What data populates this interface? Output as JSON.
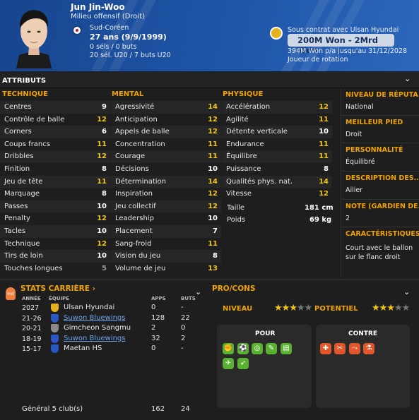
{
  "player": {
    "name": "Jun Jin-Woo",
    "position": "Milieu offensif (Droit)",
    "nationality": "Sud-Coréen",
    "age": "27 ans (9/9/1999)",
    "caps": "0 séls / 0 buts",
    "youth_caps": "20 sél. U20 / 7 buts U20"
  },
  "contract": {
    "club_text": "Sous contrat avec Ulsan Hyundai",
    "value": "200M Won - 2Mrd Won",
    "salary": "394M Won p/a jusqu'au 31/12/2028",
    "role": "Joueur de rotation"
  },
  "attributes": {
    "title": "ATTRIBUTS",
    "technique": {
      "title": "TECHNIQUE",
      "items": [
        {
          "label": "Centres",
          "value": "9"
        },
        {
          "label": "Contrôle de balle",
          "value": "12"
        },
        {
          "label": "Corners",
          "value": "6"
        },
        {
          "label": "Coups francs",
          "value": "11"
        },
        {
          "label": "Dribbles",
          "value": "12"
        },
        {
          "label": "Finition",
          "value": "8"
        },
        {
          "label": "Jeu de tête",
          "value": "11"
        },
        {
          "label": "Marquage",
          "value": "8"
        },
        {
          "label": "Passes",
          "value": "10"
        },
        {
          "label": "Penalty",
          "value": "12"
        },
        {
          "label": "Tacles",
          "value": "10"
        },
        {
          "label": "Technique",
          "value": "12"
        },
        {
          "label": "Tirs de loin",
          "value": "10"
        },
        {
          "label": "Touches longues",
          "value": "5"
        }
      ]
    },
    "mental": {
      "title": "MENTAL",
      "items": [
        {
          "label": "Agressivité",
          "value": "14"
        },
        {
          "label": "Anticipation",
          "value": "12"
        },
        {
          "label": "Appels de balle",
          "value": "12"
        },
        {
          "label": "Concentration",
          "value": "11"
        },
        {
          "label": "Courage",
          "value": "11"
        },
        {
          "label": "Décisions",
          "value": "10"
        },
        {
          "label": "Détermination",
          "value": "14"
        },
        {
          "label": "Inspiration",
          "value": "12"
        },
        {
          "label": "Jeu collectif",
          "value": "12"
        },
        {
          "label": "Leadership",
          "value": "10"
        },
        {
          "label": "Placement",
          "value": "7"
        },
        {
          "label": "Sang-froid",
          "value": "11"
        },
        {
          "label": "Vision du jeu",
          "value": "8"
        },
        {
          "label": "Volume de jeu",
          "value": "13"
        }
      ]
    },
    "physique": {
      "title": "PHYSIQUE",
      "items": [
        {
          "label": "Accélération",
          "value": "12"
        },
        {
          "label": "Agilité",
          "value": "11"
        },
        {
          "label": "Détente verticale",
          "value": "10"
        },
        {
          "label": "Endurance",
          "value": "11"
        },
        {
          "label": "Équilibre",
          "value": "11"
        },
        {
          "label": "Puissance",
          "value": "8"
        },
        {
          "label": "Qualités phys. nat.",
          "value": "14"
        },
        {
          "label": "Vitesse",
          "value": "12"
        }
      ],
      "height_label": "Taille",
      "height": "181 cm",
      "weight_label": "Poids",
      "weight": "69 kg"
    }
  },
  "side": {
    "reputation_title": "NIVEAU DE RÉPUTA...",
    "reputation": "National",
    "foot_title": "MEILLEUR PIED",
    "foot": "Droit",
    "personality_title": "PERSONNALITÉ",
    "personality": "Équilibré",
    "description_title": "DESCRIPTION DES...",
    "description": "Ailier",
    "gk_note_title": "NOTE (GARDIEN DE...",
    "gk_note": "2",
    "traits_title": "CARACTÉRISTIQUES J",
    "traits": "Court avec le ballon sur le flanc droit"
  },
  "career": {
    "badge": "Ind",
    "title": "STATS CARRIÈRE ›",
    "headers": {
      "year": "ANNÉE",
      "team": "ÉQUIPE",
      "apps": "APPS",
      "goals": "BUTS"
    },
    "rows": [
      {
        "year": "2027",
        "club": "Ulsan Hyundai",
        "apps": "0",
        "goals": "-",
        "link": false,
        "color": "#e3b21d"
      },
      {
        "year": "21-26",
        "club": "Suwon Bluewings",
        "apps": "128",
        "goals": "22",
        "link": true,
        "color": "#2a56c6"
      },
      {
        "year": "20-21",
        "club": "Gimcheon Sangmu",
        "apps": "2",
        "goals": "0",
        "link": false,
        "color": "#8a8a8a"
      },
      {
        "year": "18-19",
        "club": "Suwon Bluewings",
        "apps": "32",
        "goals": "2",
        "link": true,
        "color": "#2a56c6"
      },
      {
        "year": "15-17",
        "club": "Maetan HS",
        "apps": "0",
        "goals": "-",
        "link": false,
        "color": "#2a56c6"
      }
    ],
    "total_label": "Général 5 club(s)",
    "total_apps": "162",
    "total_goals": "24"
  },
  "procons": {
    "title": "PRO/CONS",
    "level_label": "NIVEAU",
    "potential_label": "POTENTIEL",
    "level_stars": 2.5,
    "potential_stars": 2.5,
    "pour_label": "POUR",
    "contre_label": "CONTRE"
  }
}
